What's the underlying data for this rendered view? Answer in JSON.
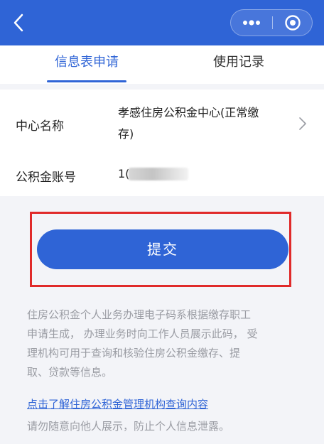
{
  "header": {
    "background": "#2f64d6",
    "back_icon": "chevron-left-icon",
    "more_icon": "more-dots-icon",
    "close_icon": "target-close-icon"
  },
  "tabs": [
    {
      "label": "信息表申请",
      "active": true
    },
    {
      "label": "使用记录",
      "active": false
    }
  ],
  "form": {
    "center_label": "中心名称",
    "center_value_line1": "孝感住房公积金中心(正常缴",
    "center_value_line2": "存)",
    "account_label": "公积金账号",
    "account_value_visible": "1("
  },
  "submit_label": "提交",
  "note": {
    "line1": "住房公积金个人业务办理电子码系根据缴存职工",
    "line2": "申请生成， 办理业务时向工作人员展示此码， 受",
    "line3": "理机构可用于查询和核验住房公积金缴存、提",
    "line4": "取、贷款等信息。",
    "link": "点击了解住房公积金管理机构查询内容",
    "warning": "请勿随意向他人展示，防止个人信息泄露。"
  },
  "colors": {
    "accent": "#2f64d6",
    "highlight_box": "#e02a2a"
  }
}
